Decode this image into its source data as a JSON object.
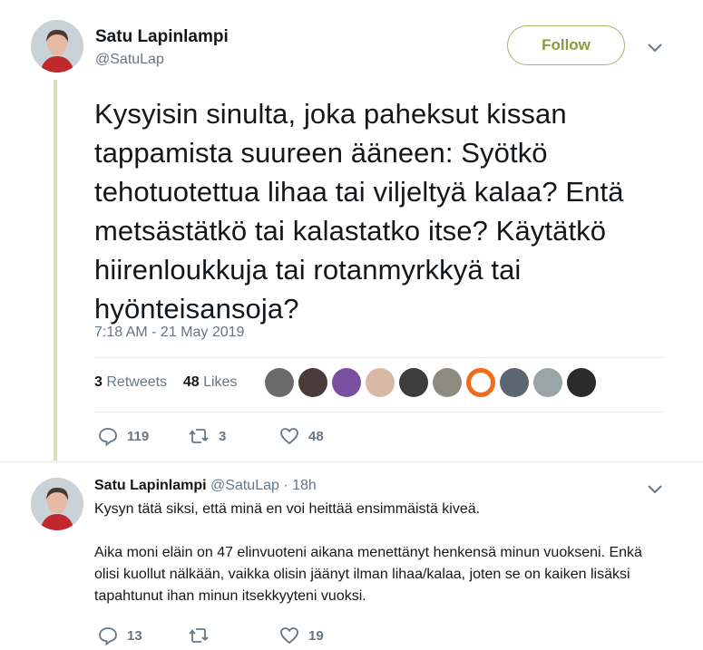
{
  "tweet": {
    "author_name": "Satu Lapinlampi",
    "author_handle": "@SatuLap",
    "follow_label": "Follow",
    "text": "Kysyisin sinulta, joka paheksut kissan tappamista suureen ääneen: Syötkö tehotuotettua lihaa tai viljeltyä kalaa? Entä metsästätkö tai kalastatko itse? Käytätkö hiirenloukkuja tai rotanmyrkkyä tai hyönteisansoja?",
    "timestamp": "7:18 AM - 21 May 2019",
    "retweets_count": "3",
    "retweets_label": "Retweets",
    "likes_count": "48",
    "likes_label": "Likes",
    "actions": {
      "replies": "119",
      "retweets": "3",
      "likes": "48"
    }
  },
  "reply": {
    "author_name": "Satu Lapinlampi",
    "author_handle": "@SatuLap",
    "separator": "·",
    "age": "18h",
    "paragraph1": "Kysyn tätä siksi, että minä en voi heittää ensimmäistä kiveä.",
    "paragraph2": "Aika moni eläin on 47 elinvuoteni aikana menettänyt henkensä minun vuokseni. Enkä olisi kuollut nälkään, vaikka olisin jäänyt ilman lihaa/kalaa, joten se on kaiken lisäksi tapahtunut ihan minun itsekkyyteni vuoksi.",
    "actions": {
      "replies": "13",
      "retweets": "",
      "likes": "19"
    }
  },
  "liker_avatar_colors": [
    "#6b6b6b",
    "#4a3b38",
    "#7a4fa0",
    "#d9b8a6",
    "#3d3d3d",
    "#8d8a80",
    "#f26a1b",
    "#5a6670",
    "#9aa5a8",
    "#2b2b2b"
  ],
  "colors": {
    "follow_accent": "#8a9a3c",
    "muted": "#657786",
    "thread_line": "#d8e0b8"
  }
}
